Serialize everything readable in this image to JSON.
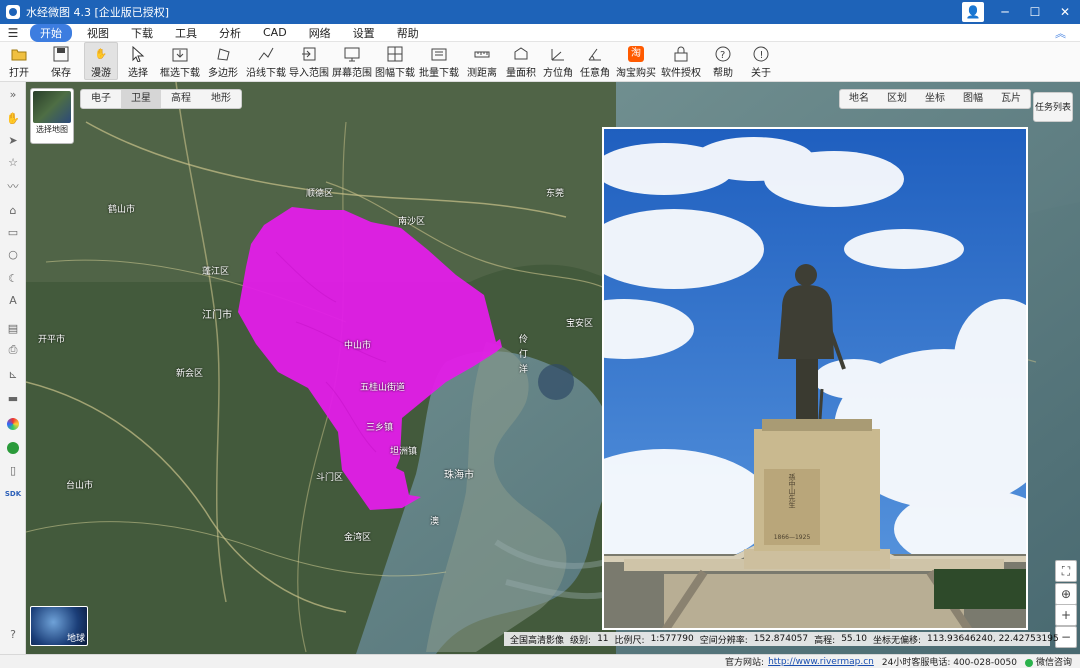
{
  "window": {
    "title": "水经微图 4.3 [企业版已授权]"
  },
  "menu": {
    "items": [
      "开始",
      "视图",
      "下载",
      "工具",
      "分析",
      "CAD",
      "网络",
      "设置",
      "帮助"
    ]
  },
  "toolbar": {
    "items": [
      "打开",
      "保存",
      "漫游",
      "选择",
      "框选下载",
      "多边形",
      "沿线下载",
      "导入范围",
      "屏幕范围",
      "图幅下载",
      "批量下载",
      "测距离",
      "量面积",
      "方位角",
      "任意角",
      "淘宝购买",
      "软件授权",
      "帮助",
      "关于"
    ]
  },
  "map_selector": {
    "label": "选择地图"
  },
  "map_tabs": [
    "电子",
    "卫星",
    "高程",
    "地形"
  ],
  "right_tabs": [
    "地名",
    "区划",
    "坐标",
    "图幅",
    "瓦片"
  ],
  "task_list": "任务列表",
  "globe_label": "地球",
  "map_labels": [
    {
      "t": "江门市"
    },
    {
      "t": "珠海市"
    },
    {
      "t": "澳"
    },
    {
      "t": "中山市"
    },
    {
      "t": "顺德区"
    },
    {
      "t": "南沙区"
    },
    {
      "t": "蓬江区"
    },
    {
      "t": "新会区"
    },
    {
      "t": "斗门区"
    },
    {
      "t": "金湾区"
    },
    {
      "t": "五桂山街道"
    },
    {
      "t": "三乡镇"
    },
    {
      "t": "坦洲镇"
    },
    {
      "t": "台山市"
    },
    {
      "t": "鹤山市"
    },
    {
      "t": "开平市"
    },
    {
      "t": "东莞"
    },
    {
      "t": "宝安区"
    },
    {
      "t": "伶仃洋"
    }
  ],
  "info": {
    "layer": "全国高清影像",
    "level_label": "级别:",
    "level": "11",
    "scale_label": "比例尺:",
    "scale": "1:577790",
    "res_label": "空间分辨率:",
    "res": "152.874057",
    "elev_label": "高程:",
    "elev": "55.10",
    "coord_label": "坐标无偏移:",
    "coord": "113.93646240, 22.42753195"
  },
  "status": {
    "site_label": "官方网站:",
    "site_url": "http://www.rivermap.cn",
    "hotline": "24小时客服电话: 400-028-0050",
    "chat": "微信咨询"
  },
  "colors": {
    "titlebar": "#1e63b8",
    "highlight_region": "#e11ee6",
    "sky": "#2d6fc8"
  },
  "statue": {
    "plaque": "孫中山先生",
    "years": "1866—1925"
  }
}
